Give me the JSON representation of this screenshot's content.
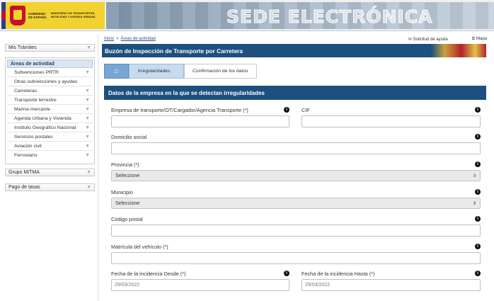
{
  "header": {
    "gov_name": "GOBIERNO DE ESPAÑA",
    "ministry_name": "MINISTERIO DE TRANSPORTES, MOVILIDAD Y AGENDA URBANA",
    "banner_title": "SEDE ELECTRÓNICA"
  },
  "nav": {
    "mis_tramites": "Mis Trámites",
    "areas_title": "Áreas de actividad",
    "areas_items": [
      "Subvenciones PRTR",
      "Otras subvenciones y ayudas",
      "Carreteras",
      "Transporte terrestre",
      "Marina mercante",
      "Agenda Urbana y Vivienda",
      "Instituto Geográfico Nacional",
      "Servicios postales",
      "Aviación civil",
      "Ferroviario"
    ],
    "grupo": "Grupo MITMA",
    "pago": "Pago de tasas"
  },
  "breadcrumb": {
    "home": "Inicio",
    "separator": ">",
    "current": "Áreas de actividad"
  },
  "toplinks": {
    "help": "Solicitud de ayuda",
    "map": "Mapa"
  },
  "page": {
    "title": "Buzón de Inspección de Transporte por Carretera"
  },
  "steps": {
    "step1": "Irregularidades",
    "step2": "Confirmación de los datos"
  },
  "form": {
    "section_title": "Datos de la empresa en la que se detectan irregularidades",
    "empresa_label": "Empresa de transporte/OT/Cargador/Agencia Transporte (*)",
    "cif_label": "CIF",
    "domicilio_label": "Domicilio social",
    "provincia_label": "Provincia (*)",
    "provincia_value": "Seleccione",
    "municipio_label": "Municipio",
    "municipio_value": "Seleccione",
    "cp_label": "Código postal",
    "matricula_label": "Matrícula del vehículo (*)",
    "fecha_desde_label": "Fecha de la incidencia Desde (*)",
    "fecha_hasta_label": "Fecha de la incidencia Hasta (*)",
    "fecha_desde_value": "29/03/2022",
    "fecha_hasta_value": "29/03/2022"
  }
}
